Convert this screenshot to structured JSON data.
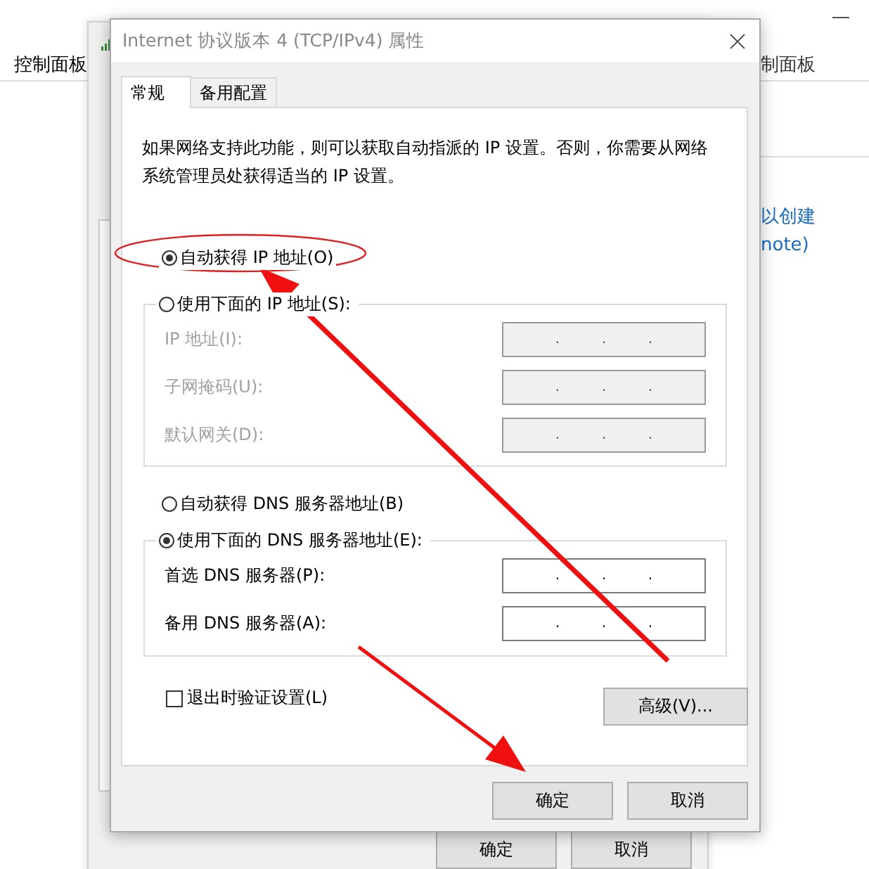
{
  "background_left": {
    "breadcrumb": "控制面板"
  },
  "background_right": {
    "breadcrumb": "制面板",
    "links": [
      "以创建",
      "note)"
    ]
  },
  "background_dialog": {
    "buttons": [
      "确定",
      "取消"
    ]
  },
  "dialog": {
    "title": "Internet 协议版本 4 (TCP/IPv4) 属性",
    "tabs": [
      {
        "label": "常规",
        "selected": true
      },
      {
        "label": "备用配置",
        "selected": false
      }
    ],
    "description": "如果网络支持此功能，则可以获取自动指派的 IP 设置。否则，你需要从网络系统管理员处获得适当的 IP 设置。",
    "ip_options": [
      {
        "label": "自动获得 IP 地址(O)",
        "selected": true
      },
      {
        "label": "使用下面的 IP 地址(S):",
        "selected": false
      }
    ],
    "ip_fields": [
      {
        "label": "IP 地址(I):",
        "disabled": true
      },
      {
        "label": "子网掩码(U):",
        "disabled": true
      },
      {
        "label": "默认网关(D):",
        "disabled": true
      }
    ],
    "dns_options": [
      {
        "label": "自动获得 DNS 服务器地址(B)",
        "selected": false
      },
      {
        "label": "使用下面的 DNS 服务器地址(E):",
        "selected": true
      }
    ],
    "dns_fields": [
      {
        "label": "首选 DNS 服务器(P):",
        "disabled": false
      },
      {
        "label": "备用 DNS 服务器(A):",
        "disabled": false
      }
    ],
    "separator": ".",
    "validate_checkbox": {
      "label": "退出时验证设置(L)",
      "checked": false
    },
    "advanced_button": "高级(V)...",
    "buttons": [
      "确定",
      "取消"
    ]
  }
}
